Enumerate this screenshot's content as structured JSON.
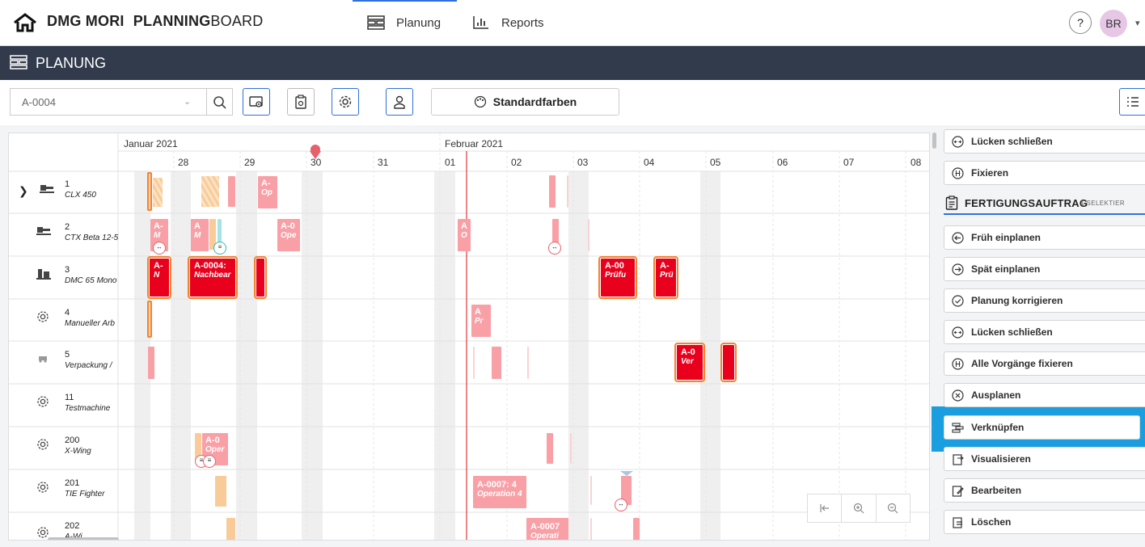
{
  "app": {
    "brand": "DMG MORI",
    "product_bold": "PLANNING",
    "product_light": "BOARD",
    "nav": [
      {
        "label": "Planung",
        "icon": "planning-icon",
        "active": true
      },
      {
        "label": "Reports",
        "icon": "reports-icon",
        "active": false
      }
    ],
    "help_label": "?",
    "user_initials": "BR"
  },
  "page": {
    "title": "PLANUNG"
  },
  "toolbar": {
    "search_value": "A-0004",
    "standard_colors_label": "Standardfarben",
    "icons": [
      "visibility-icon",
      "clipboard-visibility-icon",
      "settings-icon",
      "user-icon"
    ]
  },
  "gantt": {
    "months": [
      {
        "label": "Januar 2021"
      },
      {
        "label": "Februar 2021"
      }
    ],
    "days": [
      "28",
      "29",
      "30",
      "31",
      "01",
      "02",
      "03",
      "04",
      "05",
      "06",
      "07",
      "08"
    ],
    "rows": [
      {
        "id": "1",
        "name": "CLX 450",
        "icon": "lathe-icon",
        "expand": true
      },
      {
        "id": "2",
        "name": "CTX Beta 12-5",
        "icon": "lathe-icon"
      },
      {
        "id": "3",
        "name": "DMC 65 Mono",
        "icon": "milling-icon"
      },
      {
        "id": "4",
        "name": "Manueller Arb",
        "icon": "gear-icon"
      },
      {
        "id": "5",
        "name": "Verpackung /",
        "icon": "forklift-icon"
      },
      {
        "id": "11",
        "name": "Testmachine",
        "icon": "gear-icon"
      },
      {
        "id": "200",
        "name": "X-Wing",
        "icon": "gear-icon"
      },
      {
        "id": "201",
        "name": "TIE Fighter",
        "icon": "gear-icon"
      },
      {
        "id": "202",
        "name": "A-Wi",
        "icon": "gear-icon"
      }
    ],
    "bars": {
      "r1_op": {
        "l1": "A-",
        "l2": "Op"
      },
      "r2_a": {
        "l1": "A-",
        "l2": "M"
      },
      "r2_b": {
        "l1": "A",
        "l2": "M"
      },
      "r2_c": {
        "l1": "A-0",
        "l2": "Ope"
      },
      "r2_d": {
        "l1": "A",
        "l2": "O"
      },
      "r3_a": {
        "l1": "A-",
        "l2": "N"
      },
      "r3_b": {
        "l1": "A-0004:",
        "l2": "Nachbear"
      },
      "r3_c": {
        "l1": "A-00",
        "l2": "Prüfu"
      },
      "r3_d": {
        "l1": "A-",
        "l2": "Prü"
      },
      "r4_a": {
        "l1": "A",
        "l2": "Pr"
      },
      "r5_a": {
        "l1": "A-0",
        "l2": "Ver"
      },
      "r200_a": {
        "l1": "A-0",
        "l2": "Oper"
      },
      "r201_a": {
        "l1": "A-0007: 4",
        "l2": "Operation 4"
      },
      "r202_a": {
        "l1": "A-0007",
        "l2": "Operati"
      }
    }
  },
  "panel": {
    "top_actions": [
      {
        "label": "Lücken schließen",
        "icon": "close-gaps-icon"
      },
      {
        "label": "Fixieren",
        "icon": "fix-icon"
      }
    ],
    "section_title": "FERTIGUNGSAUFTRAG",
    "section_subtitle": "1 SELEKTIER",
    "actions": [
      {
        "label": "Früh einplanen",
        "icon": "arrow-left-circle-icon"
      },
      {
        "label": "Spät einplanen",
        "icon": "arrow-right-circle-icon"
      },
      {
        "label": "Planung korrigieren",
        "icon": "check-circle-icon"
      },
      {
        "label": "Lücken schließen",
        "icon": "close-gaps-icon"
      },
      {
        "label": "Alle Vorgänge fixieren",
        "icon": "fix-icon"
      },
      {
        "label": "Ausplanen",
        "icon": "x-circle-icon"
      },
      {
        "label": "Verknüpfen",
        "icon": "link-icon",
        "highlighted": true
      },
      {
        "label": "Visualisieren",
        "icon": "visualize-icon"
      },
      {
        "label": "Bearbeiten",
        "icon": "edit-icon"
      },
      {
        "label": "Löschen",
        "icon": "delete-icon"
      }
    ],
    "highlight_color": "#1a9ee0"
  }
}
